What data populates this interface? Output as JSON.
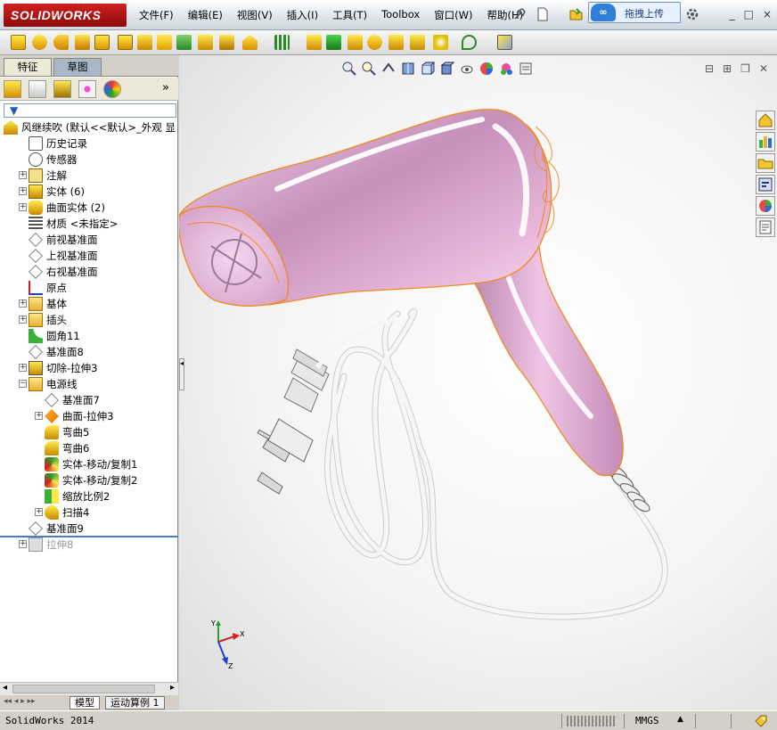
{
  "app": {
    "logo": "SOLIDWORKS",
    "menus": [
      "文件(F)",
      "编辑(E)",
      "视图(V)",
      "插入(I)",
      "工具(T)",
      "Toolbox",
      "窗口(W)",
      "帮助(H)"
    ],
    "upload_label": "拖拽上传",
    "window_controls": [
      "_",
      "□",
      "×"
    ]
  },
  "left_panel": {
    "tabs": [
      "特征",
      "草图"
    ],
    "more_label": "»",
    "tree": [
      {
        "label": "风继续吹  (默认<<默认>_外观 显",
        "icon": "part-icon",
        "expand": "",
        "indent": 0
      },
      {
        "label": "历史记录",
        "icon": "history-icon",
        "expand": "",
        "indent": 1
      },
      {
        "label": "传感器",
        "icon": "sensor-icon",
        "expand": "",
        "indent": 1
      },
      {
        "label": "注解",
        "icon": "annotation-icon",
        "expand": "+",
        "indent": 1
      },
      {
        "label": "实体 (6)",
        "icon": "solid-bodies-icon",
        "expand": "+",
        "indent": 1
      },
      {
        "label": "曲面实体 (2)",
        "icon": "surface-bodies-icon",
        "expand": "+",
        "indent": 1
      },
      {
        "label": "材质 <未指定>",
        "icon": "material-icon",
        "expand": "",
        "indent": 1
      },
      {
        "label": "前视基准面",
        "icon": "plane-icon",
        "expand": "",
        "indent": 1
      },
      {
        "label": "上视基准面",
        "icon": "plane-icon",
        "expand": "",
        "indent": 1
      },
      {
        "label": "右视基准面",
        "icon": "plane-icon",
        "expand": "",
        "indent": 1
      },
      {
        "label": "原点",
        "icon": "origin-icon",
        "expand": "",
        "indent": 1
      },
      {
        "label": "基体",
        "icon": "folder-icon",
        "expand": "+",
        "indent": 1
      },
      {
        "label": "插头",
        "icon": "folder-icon",
        "expand": "+",
        "indent": 1
      },
      {
        "label": "圆角11",
        "icon": "fillet-icon",
        "expand": "",
        "indent": 1
      },
      {
        "label": "基准面8",
        "icon": "plane-icon",
        "expand": "",
        "indent": 1
      },
      {
        "label": "切除-拉伸3",
        "icon": "cut-extrude-icon",
        "expand": "+",
        "indent": 1
      },
      {
        "label": "电源线",
        "icon": "folder-icon",
        "expand": "−",
        "indent": 1
      },
      {
        "label": "基准面7",
        "icon": "plane-icon",
        "expand": "",
        "indent": 2
      },
      {
        "label": "曲面-拉伸3",
        "icon": "surface-extrude-icon",
        "expand": "+",
        "indent": 2
      },
      {
        "label": "弯曲5",
        "icon": "flex-icon",
        "expand": "",
        "indent": 2
      },
      {
        "label": "弯曲6",
        "icon": "flex-icon",
        "expand": "",
        "indent": 2
      },
      {
        "label": "实体-移动/复制1",
        "icon": "move-copy-icon",
        "expand": "",
        "indent": 2
      },
      {
        "label": "实体-移动/复制2",
        "icon": "move-copy-icon",
        "expand": "",
        "indent": 2
      },
      {
        "label": "缩放比例2",
        "icon": "scale-icon",
        "expand": "",
        "indent": 2
      },
      {
        "label": "扫描4",
        "icon": "sweep-icon",
        "expand": "+",
        "indent": 2
      },
      {
        "label": "基准面9",
        "icon": "plane-icon",
        "expand": "",
        "indent": 1
      },
      {
        "label": "拉伸8",
        "icon": "extrude-icon",
        "expand": "+",
        "indent": 1,
        "suppressed": true
      }
    ],
    "bottom_tabs": [
      "模型",
      "运动算例 1"
    ]
  },
  "viewport": {
    "model_name": "hair-dryer-model",
    "triad_labels": {
      "x": "X",
      "y": "Y",
      "z": "Z"
    },
    "colors": {
      "body": "#e7b6d9",
      "edge": "#f08a1c",
      "cord": "#ffffff"
    }
  },
  "status": {
    "app_version": "SolidWorks 2014",
    "units": "MMGS",
    "units_caret": "▲"
  }
}
